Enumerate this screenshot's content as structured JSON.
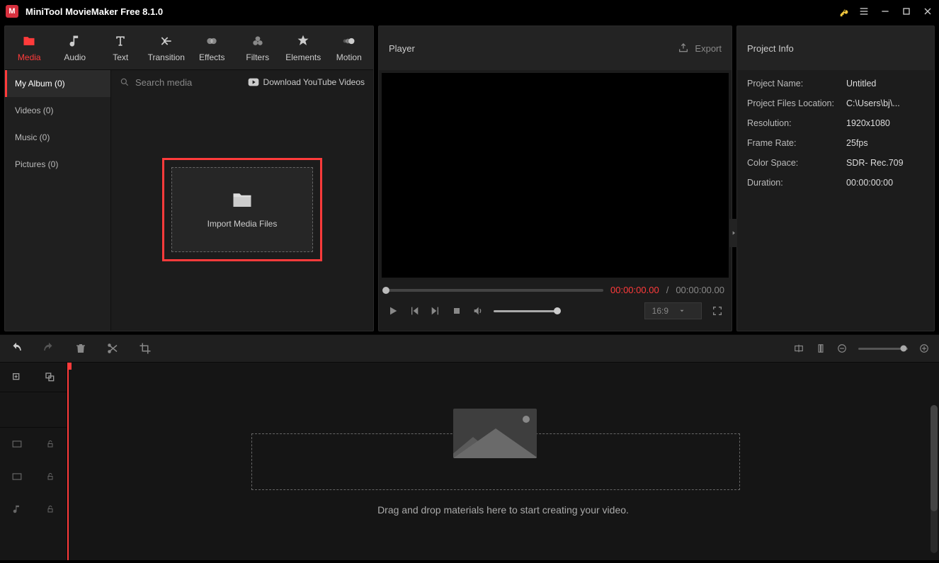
{
  "titlebar": {
    "title": "MiniTool MovieMaker Free 8.1.0",
    "logo_letter": "M"
  },
  "tabs": {
    "media": "Media",
    "audio": "Audio",
    "text": "Text",
    "transition": "Transition",
    "effects": "Effects",
    "filters": "Filters",
    "elements": "Elements",
    "motion": "Motion"
  },
  "sidebar": {
    "my_album": "My Album (0)",
    "videos": "Videos (0)",
    "music": "Music (0)",
    "pictures": "Pictures (0)"
  },
  "media": {
    "search_placeholder": "Search media",
    "download_yt": "Download YouTube Videos",
    "import_label": "Import Media Files"
  },
  "player": {
    "title": "Player",
    "export": "Export",
    "time_current": "00:00:00.00",
    "time_sep": "/",
    "time_total": "00:00:00.00",
    "aspect": "16:9"
  },
  "project_info": {
    "title": "Project Info",
    "rows": {
      "name_label": "Project Name:",
      "name_value": "Untitled",
      "location_label": "Project Files Location:",
      "location_value": "C:\\Users\\bj\\...",
      "resolution_label": "Resolution:",
      "resolution_value": "1920x1080",
      "framerate_label": "Frame Rate:",
      "framerate_value": "25fps",
      "colorspace_label": "Color Space:",
      "colorspace_value": "SDR- Rec.709",
      "duration_label": "Duration:",
      "duration_value": "00:00:00:00"
    }
  },
  "timeline": {
    "drop_hint": "Drag and drop materials here to start creating your video."
  }
}
